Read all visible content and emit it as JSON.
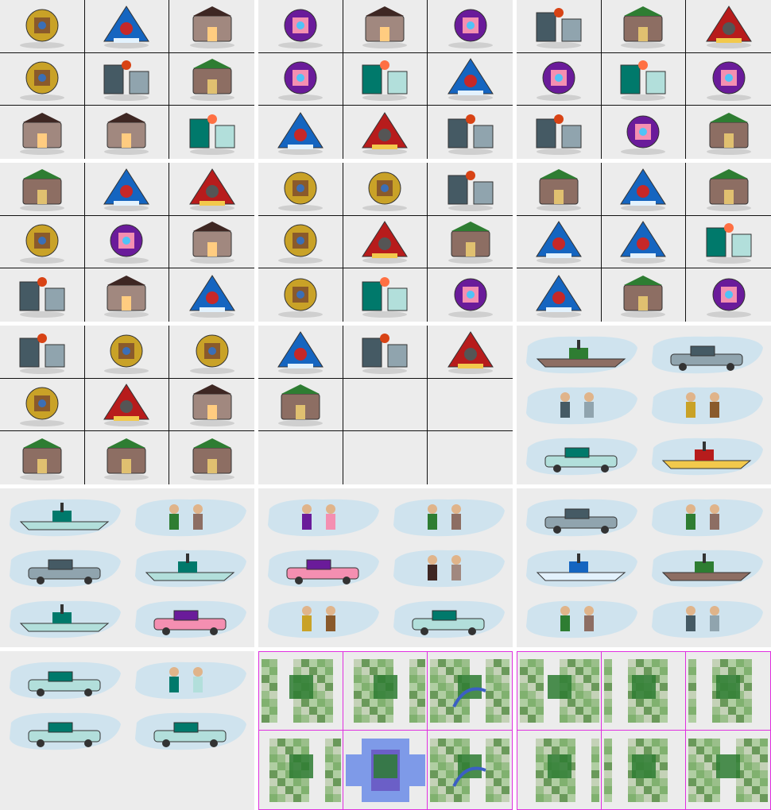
{
  "sheet": {
    "background": "#ffffff",
    "panel_color": "#ececec",
    "grid_line_color": "#111111",
    "tile_grid_color": "#e030e0"
  },
  "tech_panels": [
    {
      "icons": [
        "handshake-trade-icon",
        "castle-masonry-icon",
        "mysticism-balance-icon",
        "monarchy-eagle-icon",
        "stealth-bomber-icon",
        "crown-icon",
        "industrial-city-balloon-icon",
        "flight-wings-icon",
        "gothic-cathedral-icon"
      ]
    },
    {
      "icons": [
        "diplomacy-handshake-icon",
        "bronze-working-figure-icon",
        "pottery-cauldron-icon",
        "statue-of-liberty-icon",
        "physics-weights-icon",
        "democracy-hands-icon",
        "railroad-locomotive-icon",
        "writing-quill-icon",
        "alphabet-letters-icon"
      ]
    },
    {
      "icons": [
        "university-diploma-icon",
        "genetic-engineering-icon",
        "economics-piggy-bank-icon",
        "factory-icon",
        "construction-brick-icon",
        "nuclear-radiation-icon",
        "computer-icon",
        "medicine-caduceus-icon",
        "millstone-wheel-icon"
      ]
    },
    {
      "icons": [
        "banking-money-bags-icon",
        "bridge-building-icon",
        "combustion-engine-icon",
        "currency-coins-icon",
        "mass-production-cars-icon",
        "chemistry-cauldron-icon",
        "astronomy-telescope-icon",
        "gunpowder-musket-icon",
        "oil-refining-pump-icon"
      ]
    },
    {
      "icons": [
        "robotics-arm-icon",
        "corporation-blueprint-icon",
        "miniaturization-circuit-icon",
        "nuclear-fission-icon",
        "feudalism-shield-icon",
        "atomic-theory-icon",
        "magnetism-magnet-icon",
        "chivalry-banner-icon",
        "electricity-gramophone-icon"
      ]
    },
    {
      "icons": [
        "communism-hammer-sickle-icon",
        "literacy-books-icon",
        "space-flight-globe-icon",
        "recycling-icon",
        "explosives-dynamite-icon",
        "refining-gauges-icon",
        "automobile-car-icon",
        "steam-engine-icon",
        "navigation-wheel-icon"
      ]
    },
    {
      "icons": [
        "conscription-soldiers-icon",
        "theory-gravity-icon",
        "automation-arm-icon",
        "horseback-riding-icon",
        "mathematics-abacus-icon",
        "steel-smelting-icon",
        "pottery-vase-icon",
        "laser-circuit-icon",
        "economics-chart-icon"
      ]
    },
    {
      "icons": [
        "superconductor-icon",
        "philosophy-thinker-icon",
        "pharaoh-sarcophagus-icon",
        "rocketry-launch-icon",
        "",
        "",
        "",
        "",
        ""
      ]
    }
  ],
  "unit_panels": [
    {
      "units": [
        "musketeers-unit",
        "battleship-unit",
        "ironclad-unit",
        "fighter-jet-unit",
        "transport-ship-unit",
        "bomber-unit"
      ]
    },
    {
      "units": [
        "armor-tank-unit",
        "frigate-unit",
        "trireme-unit",
        "caravel-unit",
        "catapult-unit",
        "cannon-unit"
      ]
    },
    {
      "units": [
        "mech-infantry-unit",
        "diplomat-unit",
        "cruiser-unit",
        "knights-unit",
        "partisans-unit",
        "submarine-unit"
      ]
    },
    {
      "units": [
        "cruise-missile-unit",
        "carrier-unit",
        "alpine-troops-unit",
        "sail-ship-unit",
        "chariot-unit",
        "riflemen-unit"
      ]
    },
    {
      "units": [
        "phalanx-unit",
        "legion-unit",
        "camel-riders-unit",
        "mounted-knight-unit",
        "",
        ""
      ]
    }
  ],
  "tile_panels": [
    {
      "tiles": [
        "grassland-tile",
        "forest-tile",
        "river-tile",
        "ocean-patch-tile",
        "water-tile",
        "river-bend-tile"
      ]
    },
    {
      "tiles": [
        "fish-grass-tile",
        "plains-tile",
        "hills-tile",
        "swamp-tile",
        "road-tile",
        "mountain-tile"
      ]
    }
  ]
}
